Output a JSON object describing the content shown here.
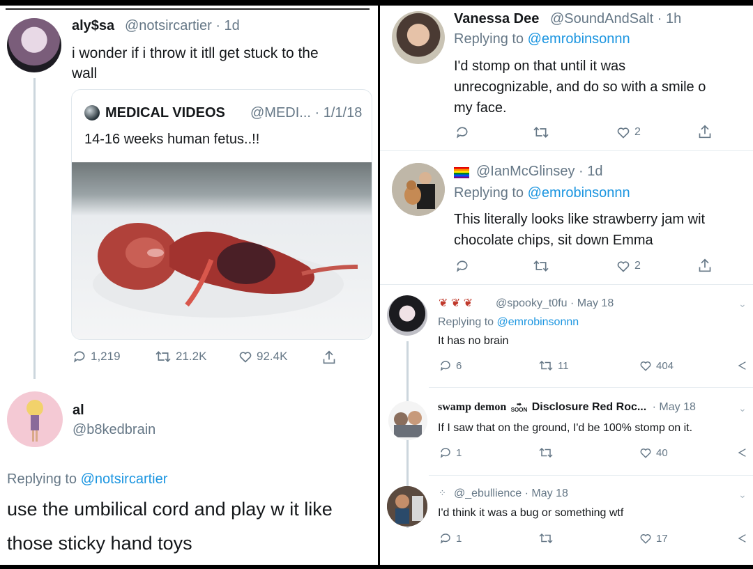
{
  "left": {
    "tweet1": {
      "name": "aly$sa",
      "handle_time": "@notsircartier · 1d",
      "text_line1": "i wonder if i throw it itll get stuck to the",
      "text_line2": "wall",
      "quote": {
        "name": "MEDICAL VIDEOS",
        "handle_time": "@MEDI... · 1/1/18",
        "text": "14-16 weeks human fetus..!!"
      },
      "replies": "1,219",
      "retweets": "21.2K",
      "likes": "92.4K"
    },
    "tweet2": {
      "name": "al",
      "handle": "@b8kedbrain",
      "replying_prefix": "Replying to",
      "replying_to": "@notsircartier",
      "text_line1": "use the umbilical cord and play w it like",
      "text_line2": "those sticky hand toys"
    }
  },
  "right": {
    "reply1": {
      "name": "Vanessa Dee",
      "handle_time": "@SoundAndSalt · 1h",
      "replying_prefix": "Replying to",
      "replying_to": "@emrobinsonnn",
      "text_line1": "I'd stomp on that until it was",
      "text_line2": "unrecognizable, and do so with a smile o",
      "text_line3": "my face.",
      "likes": "2"
    },
    "reply2": {
      "handle_time": "@IanMcGlinsey · 1d",
      "replying_prefix": "Replying to",
      "replying_to": "@emrobinsonnn",
      "text_line1": "This literally looks like strawberry jam wit",
      "text_line2": "chocolate chips, sit down Emma",
      "likes": "2"
    },
    "reply3": {
      "handle_time": "@spooky_t0fu · May 18",
      "replying_prefix": "Replying to",
      "replying_to": "@emrobinsonnn",
      "text": "It has no brain",
      "replies": "6",
      "retweets": "11",
      "likes": "404"
    },
    "reply4": {
      "name": "swamp demon",
      "name2": "Disclosure Red Roc...",
      "time": "· May 18",
      "soon": "SOON",
      "text": "If I saw that on the ground, I'd be 100% stomp on it.",
      "replies": "1",
      "likes": "40"
    },
    "reply5": {
      "handle_time": "@_ebullience · May 18",
      "text": "I'd think it was a bug or something wtf",
      "replies": "1",
      "likes": "17"
    }
  },
  "colors": {
    "link": "#1b95e0",
    "muted": "#657786",
    "line": "#ccd6dd"
  },
  "icons": [
    "reply-icon",
    "retweet-icon",
    "like-icon",
    "share-icon",
    "chevron-down-icon",
    "globe-icon",
    "rainbow-flag-icon",
    "rose-icon"
  ]
}
